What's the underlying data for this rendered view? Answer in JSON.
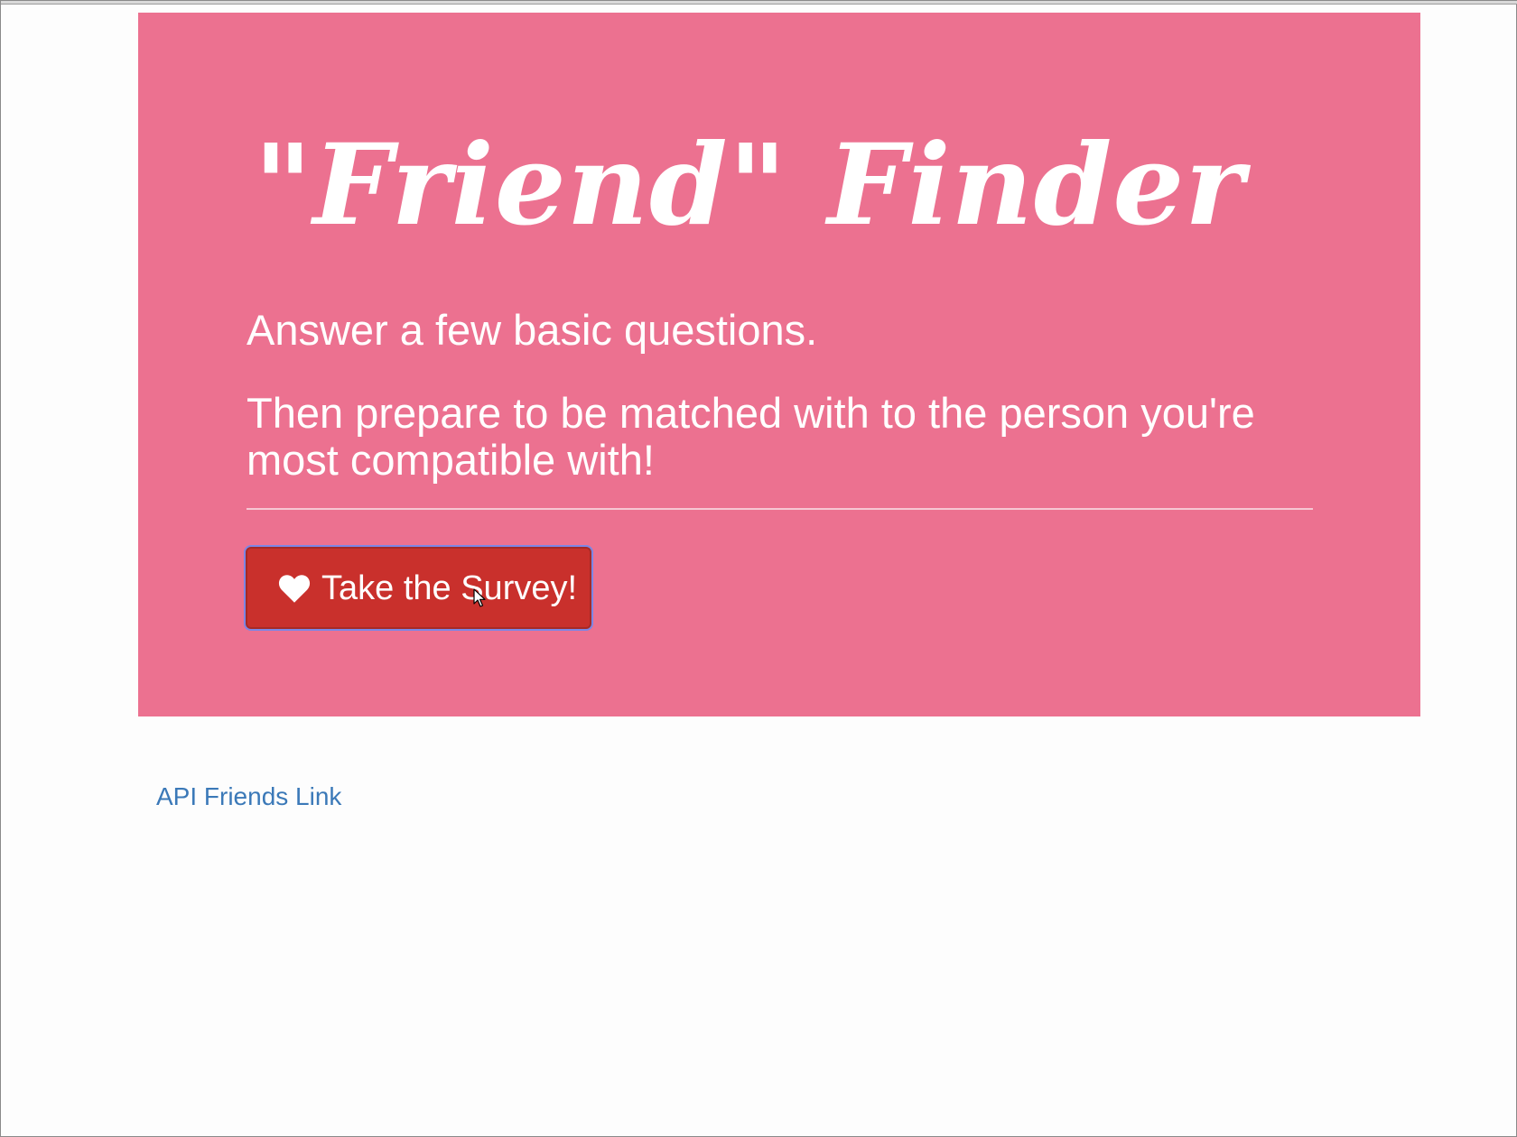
{
  "jumbotron": {
    "title": "\"Friend\" Finder",
    "lead_1": "Answer a few basic questions.",
    "lead_2": "Then prepare to be matched with to the person you're most compatible with!",
    "button": {
      "icon": "heart-icon",
      "label": "Take the Survey!"
    },
    "colors": {
      "background": "#ec7190",
      "button": "#c9302c",
      "text": "#ffffff"
    }
  },
  "footer": {
    "link_label": "API Friends Link",
    "link_color": "#3b79b8"
  }
}
